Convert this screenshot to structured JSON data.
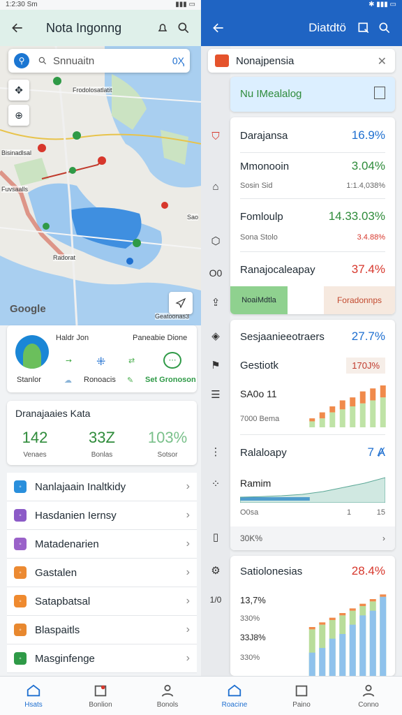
{
  "left": {
    "status_time": "1:2:30 Sm",
    "app_title": "Nota Ingonng",
    "search_placeholder": "Snnuaitn",
    "search_clear": "0Ҳ",
    "map_labels": [
      "Frodolosatlatit",
      "Bisinadlsal",
      "Fuvsaalls",
      "Sao",
      "Radorat",
      "Geatoonas3"
    ],
    "google_label": "Google",
    "location_card": {
      "name": "Haldr Jon",
      "subtitle": "Paneabie Dione",
      "logo_caption": "Stanlor",
      "action_mid": "Ronoacis",
      "action_right": "Set Gronoson"
    },
    "stats": {
      "title": "Dranajaaies Kata",
      "items": [
        {
          "value": "142",
          "label": "Venaes"
        },
        {
          "value": "33Z",
          "label": "Bonlas"
        },
        {
          "value": "103%",
          "label": "Sotsor"
        }
      ]
    },
    "menu": [
      {
        "label": "Nanlajaain Inaltkidy",
        "color": "#2a8fdc"
      },
      {
        "label": "Hasdanien Iernsy",
        "color": "#8c5bc7"
      },
      {
        "label": "Matadenarien",
        "color": "#9a62c9"
      },
      {
        "label": "Gastalen",
        "color": "#ec8a32"
      },
      {
        "label": "Satapbatsal",
        "color": "#ef8a2f"
      },
      {
        "label": "Blaspaitls",
        "color": "#e8882f"
      },
      {
        "label": "Masginfenge",
        "color": "#2f9a47"
      }
    ],
    "nav": [
      {
        "label": "Hsats",
        "icon": "home-icon"
      },
      {
        "label": "Bonlion",
        "icon": "calendar-icon"
      },
      {
        "label": "Bonols",
        "icon": "person-icon"
      }
    ]
  },
  "right": {
    "app_title": "Diatdtö",
    "notice": "Nonajpensia",
    "banner": "Nu IMealalog",
    "list": [
      {
        "name": "Darajansa",
        "pct": "16.9%",
        "tone": "blue"
      },
      {
        "name": "Mmonooin",
        "pct": "3.04%",
        "tone": "green",
        "sub_left": "Sosin Sid",
        "sub_right": "1:1.4,038%"
      },
      {
        "name": "Fomloulp",
        "pct": "14.33.03%",
        "tone": "green",
        "sub_left": "Sona Stolo",
        "sub_right": "3.4.88%"
      },
      {
        "name": "Ranajocaleapay",
        "pct": "37.4%",
        "tone": "red"
      }
    ],
    "btn_left": "NoaiMdtla",
    "btn_right": "Foradonnps",
    "section2": {
      "title": "Sesjaanieeotraers",
      "pct": "27.7%",
      "row2_name": "Gestiotk",
      "row2_val": "170J%",
      "row3_name": "SA0o 11",
      "row3_sub": "7000 Bema",
      "row4_name": "Ralaloapy",
      "row4_val": "7 Ⱥ",
      "row5_name": "Ramim",
      "row5_left": "O0sa",
      "row5_mid": "1",
      "row5_right": "15",
      "footer": "30K%"
    },
    "progress": 0.48,
    "section3": {
      "title": "Satiolonesias",
      "pct": "28.4%",
      "lines": [
        "13,7%",
        "330%",
        "33J8%",
        "330%"
      ]
    },
    "rail_labels": [
      "O0",
      "1/0"
    ],
    "nav": [
      {
        "label": "Roacine",
        "icon": "home-icon"
      },
      {
        "label": "Paino",
        "icon": "calendar-icon"
      },
      {
        "label": "Conno",
        "icon": "person-icon"
      }
    ]
  },
  "chart_data": [
    {
      "type": "bar",
      "series": [
        {
          "values": [
            2,
            3,
            5,
            6,
            7,
            8,
            9,
            10
          ]
        },
        {
          "values": [
            1,
            2,
            2,
            3,
            3,
            4,
            4,
            4
          ]
        }
      ]
    },
    {
      "type": "area",
      "values": [
        2,
        2.2,
        2.5,
        3,
        4,
        5.5,
        7,
        9
      ]
    },
    {
      "type": "bar",
      "series": [
        {
          "values": [
            10,
            11,
            12,
            13,
            14,
            15,
            16,
            17
          ]
        },
        {
          "values": [
            5,
            6,
            8,
            9,
            11,
            13,
            14,
            17
          ]
        },
        {
          "values": [
            1,
            1,
            1,
            1,
            1,
            1,
            1,
            1
          ]
        }
      ]
    }
  ]
}
